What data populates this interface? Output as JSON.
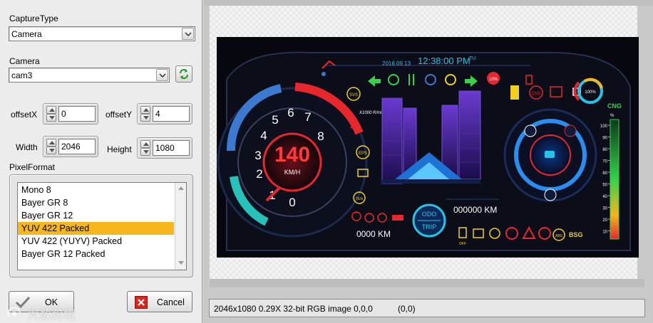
{
  "capture_type": {
    "label": "CaptureType",
    "value": "Camera"
  },
  "camera": {
    "label": "Camera",
    "value": "cam3"
  },
  "offset_x": {
    "label": "offsetX",
    "value": "0"
  },
  "offset_y": {
    "label": "offsetY",
    "value": "4"
  },
  "width": {
    "label": "Width",
    "value": "2046"
  },
  "height": {
    "label": "Height",
    "value": "1080"
  },
  "pixel_format": {
    "label": "PixelFormat",
    "options": [
      "Mono 8",
      "Bayer GR 8",
      "Bayer GR 12",
      "YUV 422 Packed",
      "YUV 422 (YUYV) Packed",
      "Bayer GR 12 Packed"
    ],
    "selected": "YUV 422 Packed"
  },
  "buttons": {
    "ok": "OK",
    "cancel": "Cancel"
  },
  "status": {
    "info": "2046x1080 0.29X 32-bit RGB image 0,0,0",
    "coords": "(0,0)"
  },
  "watermark": "大数跨境",
  "dashboard": {
    "date": "2016.09.13",
    "time": "12:38:00 PM",
    "time_suffix": "TU",
    "speed": "140",
    "speed_unit": "KM/H",
    "rpm_label": "X1000 R/min",
    "gauge_numbers": [
      "0",
      "1",
      "2",
      "3",
      "4",
      "5",
      "6",
      "7",
      "8"
    ],
    "odometer": "000000 KM",
    "trip": "0000 KM",
    "odo_label": "ODO",
    "trip_label": "TRIP",
    "cng_label": "CNG",
    "cng_ticks": [
      "100",
      "90",
      "80",
      "70",
      "60",
      "50",
      "40",
      "30",
      "20",
      "10"
    ],
    "percent_label": "100%",
    "percent_small": "10%",
    "bsg_label": "BSG",
    "abs_label": "ABS",
    "cng_badge": "CNG",
    "svs_label": "SVS",
    "eps_label": "EPS",
    "off_label": "OFF",
    "ten_label": "TEN",
    "pct_sign": "%",
    "colors": {
      "cyan": "#25c3e6",
      "red": "#e8262e",
      "green": "#34d34a",
      "yellow": "#f0d21a",
      "orange": "#f7b61a"
    }
  }
}
